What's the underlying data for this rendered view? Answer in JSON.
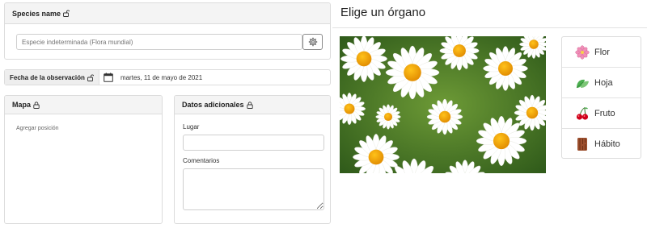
{
  "species": {
    "header": "Species name",
    "placeholder": "Especie indeterminada (Flora mundial)"
  },
  "observation": {
    "date_label": "Fecha de la observación",
    "date_value": "martes, 11 de mayo de 2021"
  },
  "map": {
    "header": "Mapa",
    "add_position": "Agregar posición"
  },
  "additional": {
    "header": "Datos adicionales",
    "lugar_label": "Lugar",
    "comentarios_label": "Comentarios"
  },
  "organ": {
    "title": "Elige un órgano",
    "items": [
      {
        "label": "Flor",
        "icon": "flower-icon"
      },
      {
        "label": "Hoja",
        "icon": "leaf-icon"
      },
      {
        "label": "Fruto",
        "icon": "cherry-icon"
      },
      {
        "label": "Hábito",
        "icon": "bark-icon"
      }
    ]
  },
  "colors": {
    "header_bg": "#f4f4f4",
    "border": "#dcdcdc",
    "flower_center": "#f5a200",
    "petal": "#ffffff",
    "foliage": "#4f7f2a"
  }
}
